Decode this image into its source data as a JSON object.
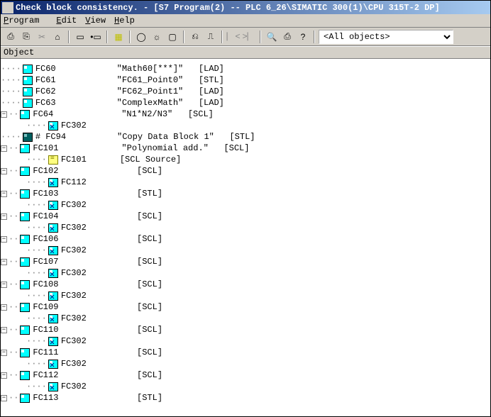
{
  "title": "Check block consistency. - [S7 Program(2) -- PLC 6_26\\SIMATIC 300(1)\\CPU 315T-2 DP]",
  "menu": {
    "program": "Program",
    "edit": "Edit",
    "view": "View",
    "help": "Help"
  },
  "toolbar": {
    "combo_value": "<All objects>"
  },
  "header": {
    "col1": "Object"
  },
  "tree": [
    {
      "ind": 0,
      "exp": null,
      "icon": "block",
      "name": "FC60",
      "desc": "\"Math60[***]\"",
      "lang": "[LAD]"
    },
    {
      "ind": 0,
      "exp": null,
      "icon": "block",
      "name": "FC61",
      "desc": "\"FC61_Point0\"",
      "lang": "[STL]"
    },
    {
      "ind": 0,
      "exp": null,
      "icon": "block",
      "name": "FC62",
      "desc": "\"FC62_Point1\"",
      "lang": "[LAD]"
    },
    {
      "ind": 0,
      "exp": null,
      "icon": "block",
      "name": "FC63",
      "desc": "\"ComplexMath\"",
      "lang": "[LAD]"
    },
    {
      "ind": 0,
      "exp": "-",
      "icon": "block",
      "name": "FC64",
      "desc": "\"N1*N2/N3\"",
      "lang": "[SCL]"
    },
    {
      "ind": 1,
      "exp": null,
      "icon": "block-x",
      "name": "FC302",
      "desc": "",
      "lang": ""
    },
    {
      "ind": 0,
      "exp": null,
      "icon": "dark",
      "name": "# FC94",
      "desc": "\"Copy Data Block 1\"",
      "lang": "[STL]"
    },
    {
      "ind": 0,
      "exp": "-",
      "icon": "block",
      "name": "FC101",
      "desc": "\"Polynomial add.\"",
      "lang": "[SCL]"
    },
    {
      "ind": 1,
      "exp": null,
      "icon": "src",
      "name": "FC101",
      "desc": "[SCL Source]",
      "lang": ""
    },
    {
      "ind": 0,
      "exp": "-",
      "icon": "block",
      "name": "FC102",
      "desc": "",
      "lang": "[SCL]"
    },
    {
      "ind": 1,
      "exp": null,
      "icon": "block-x",
      "name": "FC112",
      "desc": "",
      "lang": ""
    },
    {
      "ind": 0,
      "exp": "-",
      "icon": "block",
      "name": "FC103",
      "desc": "",
      "lang": "[STL]"
    },
    {
      "ind": 1,
      "exp": null,
      "icon": "block-x",
      "name": "FC302",
      "desc": "",
      "lang": ""
    },
    {
      "ind": 0,
      "exp": "-",
      "icon": "block",
      "name": "FC104",
      "desc": "",
      "lang": "[SCL]"
    },
    {
      "ind": 1,
      "exp": null,
      "icon": "block-x",
      "name": "FC302",
      "desc": "",
      "lang": ""
    },
    {
      "ind": 0,
      "exp": "-",
      "icon": "block",
      "name": "FC106",
      "desc": "",
      "lang": "[SCL]"
    },
    {
      "ind": 1,
      "exp": null,
      "icon": "block-x",
      "name": "FC302",
      "desc": "",
      "lang": ""
    },
    {
      "ind": 0,
      "exp": "-",
      "icon": "block",
      "name": "FC107",
      "desc": "",
      "lang": "[SCL]"
    },
    {
      "ind": 1,
      "exp": null,
      "icon": "block-x",
      "name": "FC302",
      "desc": "",
      "lang": ""
    },
    {
      "ind": 0,
      "exp": "-",
      "icon": "block",
      "name": "FC108",
      "desc": "",
      "lang": "[SCL]"
    },
    {
      "ind": 1,
      "exp": null,
      "icon": "block-x",
      "name": "FC302",
      "desc": "",
      "lang": ""
    },
    {
      "ind": 0,
      "exp": "-",
      "icon": "block",
      "name": "FC109",
      "desc": "",
      "lang": "[SCL]"
    },
    {
      "ind": 1,
      "exp": null,
      "icon": "block-x",
      "name": "FC302",
      "desc": "",
      "lang": ""
    },
    {
      "ind": 0,
      "exp": "-",
      "icon": "block",
      "name": "FC110",
      "desc": "",
      "lang": "[SCL]"
    },
    {
      "ind": 1,
      "exp": null,
      "icon": "block-x",
      "name": "FC302",
      "desc": "",
      "lang": ""
    },
    {
      "ind": 0,
      "exp": "-",
      "icon": "block",
      "name": "FC111",
      "desc": "",
      "lang": "[SCL]"
    },
    {
      "ind": 1,
      "exp": null,
      "icon": "block-x",
      "name": "FC302",
      "desc": "",
      "lang": ""
    },
    {
      "ind": 0,
      "exp": "-",
      "icon": "block",
      "name": "FC112",
      "desc": "",
      "lang": "[SCL]"
    },
    {
      "ind": 1,
      "exp": null,
      "icon": "block-x",
      "name": "FC302",
      "desc": "",
      "lang": ""
    },
    {
      "ind": 0,
      "exp": "-",
      "icon": "block",
      "name": "FC113",
      "desc": "",
      "lang": "[STL]"
    }
  ]
}
